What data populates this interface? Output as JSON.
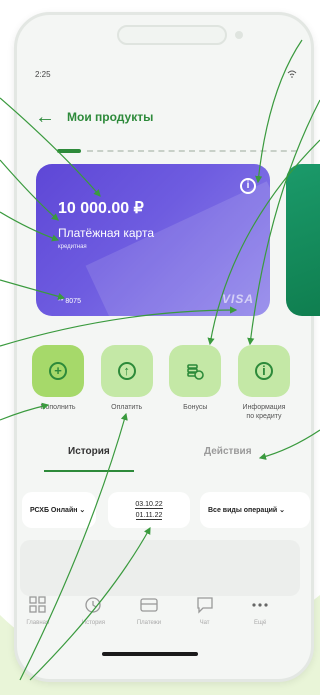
{
  "status_bar": {
    "time": "2:25"
  },
  "header": {
    "title": "Мои продукты"
  },
  "card": {
    "balance": "10 000.00 ₽",
    "name": "Платёжная карта",
    "type": "кредитная",
    "number": "** 8075",
    "brand": "VISA",
    "gradient_start": "#5e47d6",
    "gradient_end": "#8f84ea"
  },
  "actions": [
    {
      "label": "Пополнить",
      "icon": "plus-circle-icon"
    },
    {
      "label": "Оплатить",
      "icon": "arrow-up-circle-icon"
    },
    {
      "label": "Бонусы",
      "icon": "coins-icon"
    },
    {
      "label_line1": "Информация",
      "label_line2": "по кредиту",
      "icon": "info-circle-icon"
    }
  ],
  "tabs": {
    "history": "История",
    "actions": "Действия"
  },
  "filters": {
    "bank": "РСХБ Онлайн",
    "date_from": "03.10.22",
    "date_to": "01.11.22",
    "operations": "Все виды операций"
  },
  "bottom_nav": [
    {
      "label": "Главная",
      "icon": "grid-icon"
    },
    {
      "label": "История",
      "icon": "clock-icon"
    },
    {
      "label": "Платежи",
      "icon": "card-icon"
    },
    {
      "label": "Чат",
      "icon": "chat-icon"
    },
    {
      "label": "Ещё",
      "icon": "more-icon"
    }
  ],
  "colors": {
    "accent": "#2d8a3a",
    "action_button": "#c4e8a6",
    "action_button_primary": "#a6d96a",
    "annotation_line": "#3a9a3e"
  }
}
